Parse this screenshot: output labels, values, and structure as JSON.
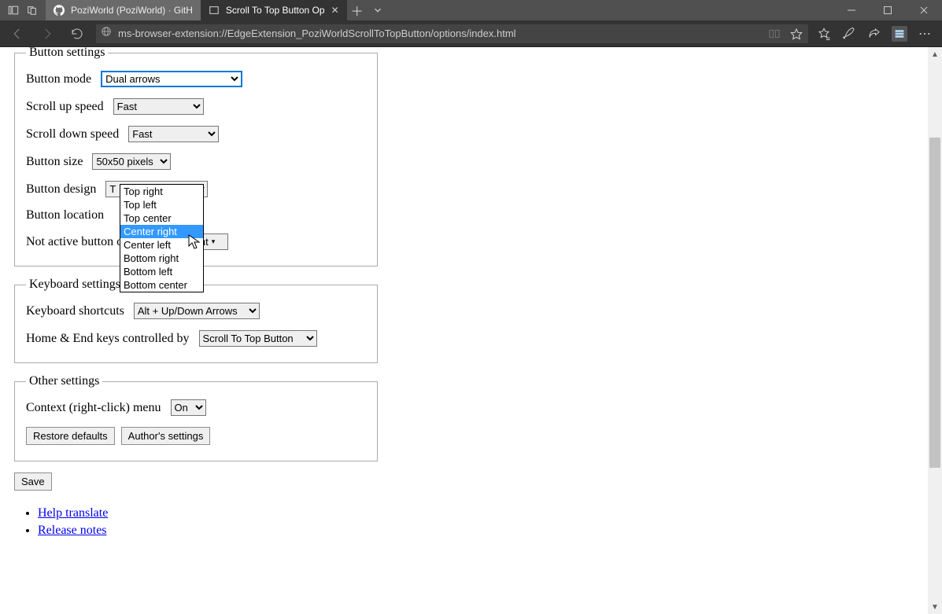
{
  "browser": {
    "tabs": [
      {
        "label": "PoziWorld (PoziWorld) · GitH",
        "active": false
      },
      {
        "label": "Scroll To Top Button Op",
        "active": true
      }
    ],
    "url": "ms-browser-extension://EdgeExtension_PoziWorldScrollToTopButton/options/index.html"
  },
  "button_settings": {
    "legend": "Button settings",
    "mode_label": "Button mode",
    "mode_value": "Dual arrows",
    "scroll_up_label": "Scroll up speed",
    "scroll_up_value": "Fast",
    "scroll_down_label": "Scroll down speed",
    "scroll_down_value": "Fast",
    "size_label": "Button size",
    "size_value": "50x50 pixels",
    "design_label": "Button design",
    "design_value": "T",
    "location_label": "Button location",
    "location_options": [
      "Top right",
      "Top left",
      "Top center",
      "Center right",
      "Center left",
      "Bottom right",
      "Bottom left",
      "Bottom center"
    ],
    "location_highlighted": "Center right",
    "opacity_label": "Not active button o",
    "opacity_value_fragment": "arent"
  },
  "keyboard_settings": {
    "legend": "Keyboard settings",
    "shortcuts_label": "Keyboard shortcuts",
    "shortcuts_value": "Alt + Up/Down Arrows",
    "home_end_label": "Home & End keys controlled by",
    "home_end_value": "Scroll To Top Button"
  },
  "other_settings": {
    "legend": "Other settings",
    "context_label": "Context (right-click) menu",
    "context_value": "On",
    "restore_label": "Restore defaults",
    "authors_label": "Author's settings"
  },
  "save_label": "Save",
  "links": {
    "help_translate": "Help translate",
    "release_notes": "Release notes"
  }
}
